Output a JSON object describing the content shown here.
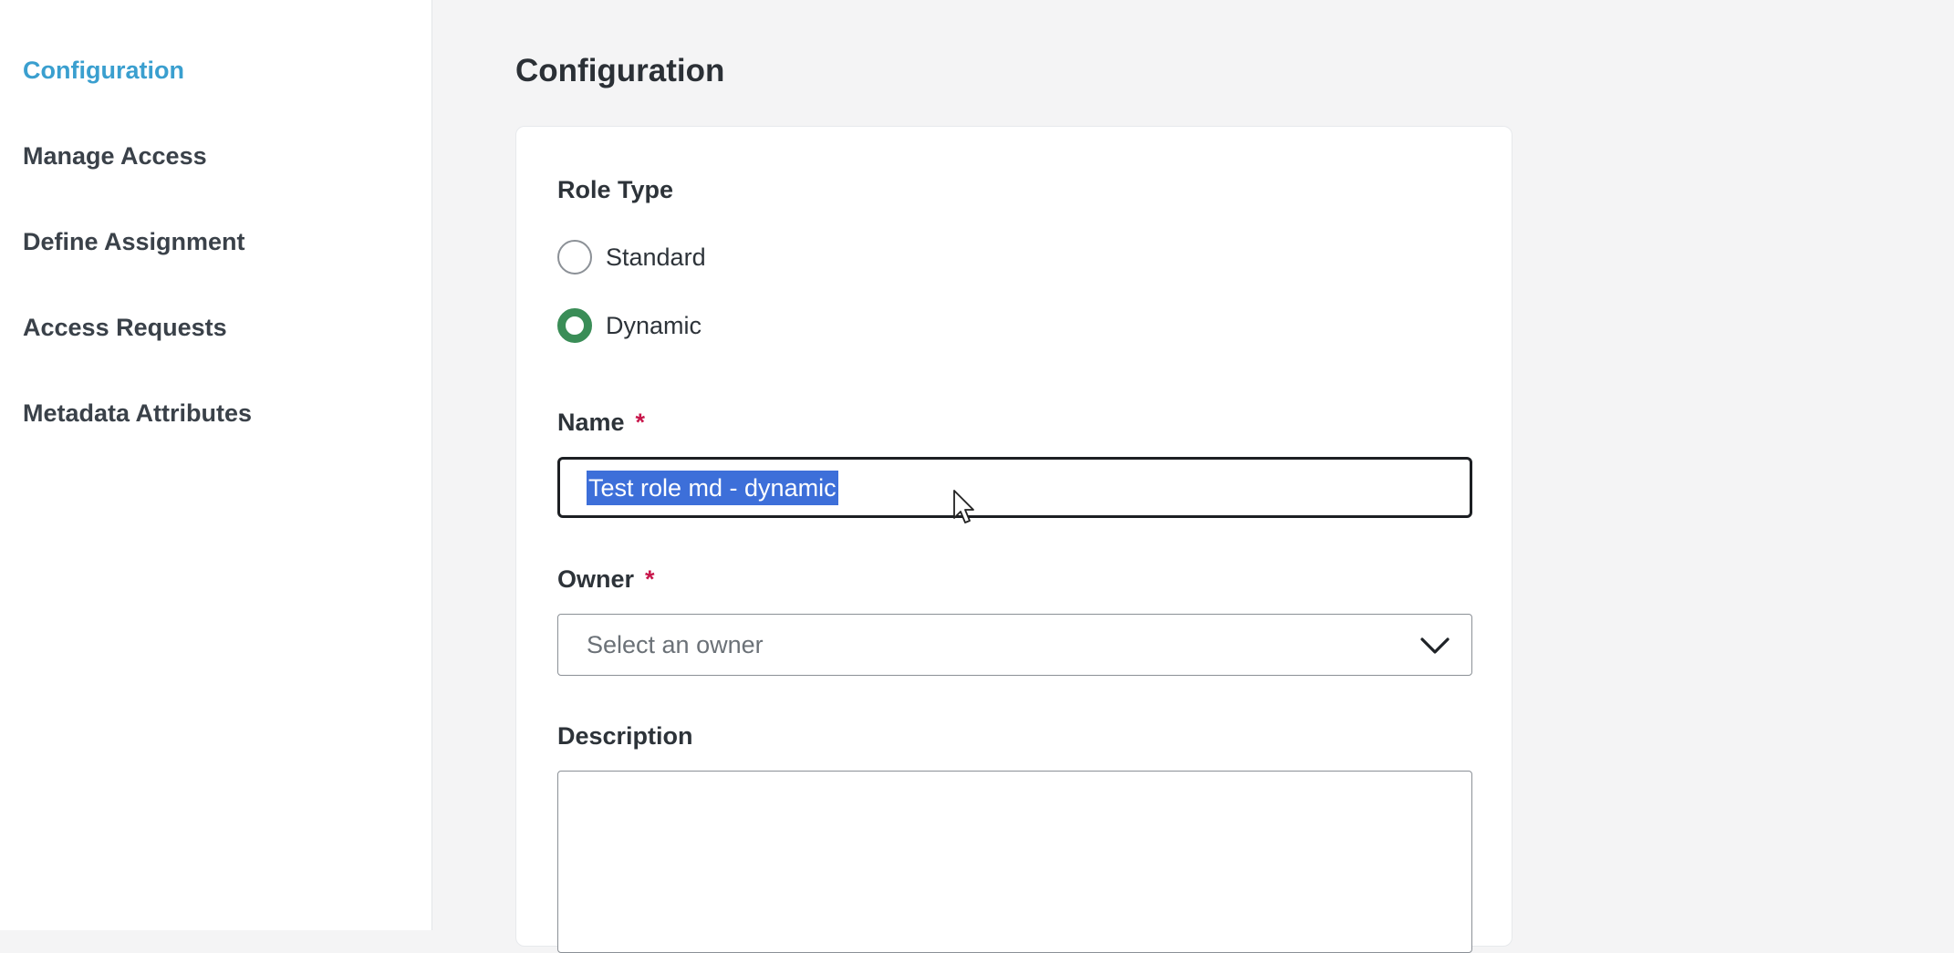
{
  "sidebar": {
    "items": [
      {
        "label": "Configuration",
        "active": true
      },
      {
        "label": "Manage Access",
        "active": false
      },
      {
        "label": "Define Assignment",
        "active": false
      },
      {
        "label": "Access Requests",
        "active": false
      },
      {
        "label": "Metadata Attributes",
        "active": false
      }
    ]
  },
  "main": {
    "title": "Configuration",
    "form": {
      "role_type": {
        "label": "Role Type",
        "options": [
          {
            "label": "Standard",
            "checked": false
          },
          {
            "label": "Dynamic",
            "checked": true
          }
        ]
      },
      "name": {
        "label": "Name",
        "required_marker": "*",
        "value": "Test role md - dynamic"
      },
      "owner": {
        "label": "Owner",
        "required_marker": "*",
        "placeholder": "Select an owner"
      },
      "description": {
        "label": "Description",
        "value": ""
      }
    }
  },
  "colors": {
    "active_nav": "#3a9fcf",
    "radio_checked": "#3a8d57",
    "required": "#c8174b",
    "selection": "#3d6fd9"
  },
  "icons": {
    "owner_dropdown": "chevron-down-icon",
    "pointer": "mouse-cursor-icon"
  }
}
